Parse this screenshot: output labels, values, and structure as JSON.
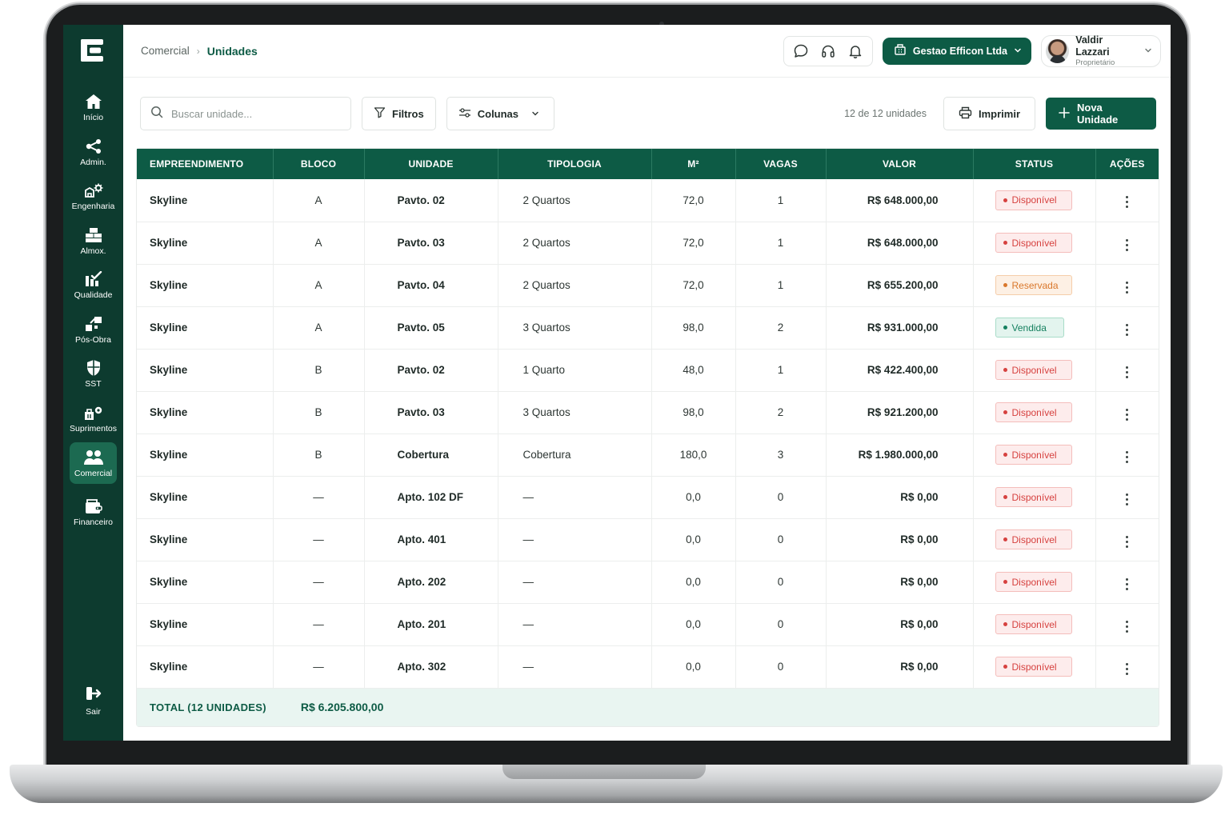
{
  "sidebar": {
    "items": [
      {
        "label": "Início",
        "icon": "home-icon"
      },
      {
        "label": "Admin.",
        "icon": "share-network-icon"
      },
      {
        "label": "Engenharia",
        "icon": "engineering-icon"
      },
      {
        "label": "Almox.",
        "icon": "warehouse-icon"
      },
      {
        "label": "Qualidade",
        "icon": "quality-check-icon"
      },
      {
        "label": "Pós-Obra",
        "icon": "post-construction-icon"
      },
      {
        "label": "SST",
        "icon": "shield-icon"
      },
      {
        "label": "Suprimentos",
        "icon": "supplies-icon"
      },
      {
        "label": "Comercial",
        "icon": "users-icon",
        "active": true
      },
      {
        "label": "Financeiro",
        "icon": "wallet-icon"
      }
    ],
    "logout_label": "Sair"
  },
  "header": {
    "breadcrumb_parent": "Comercial",
    "breadcrumb_current": "Unidades",
    "company": "Gestao Efficon Ltda",
    "user_name": "Valdir Lazzari",
    "user_role": "Proprietário"
  },
  "toolbar": {
    "search_placeholder": "Buscar unidade...",
    "filters_label": "Filtros",
    "columns_label": "Colunas",
    "count_text": "12 de 12 unidades",
    "print_label": "Imprimir",
    "new_label": "Nova Unidade"
  },
  "table": {
    "headers": [
      "EMPREENDIMENTO",
      "BLOCO",
      "UNIDADE",
      "TIPOLOGIA",
      "M²",
      "VAGAS",
      "VALOR",
      "STATUS",
      "AÇÕES"
    ],
    "rows": [
      {
        "emp": "Skyline",
        "bloco": "A",
        "unidade": "Pavto. 02",
        "tipologia": "2 Quartos",
        "m2": "72,0",
        "vagas": "1",
        "valor": "R$ 648.000,00",
        "status": "Disponível",
        "status_type": "disponivel"
      },
      {
        "emp": "Skyline",
        "bloco": "A",
        "unidade": "Pavto. 03",
        "tipologia": "2 Quartos",
        "m2": "72,0",
        "vagas": "1",
        "valor": "R$ 648.000,00",
        "status": "Disponível",
        "status_type": "disponivel"
      },
      {
        "emp": "Skyline",
        "bloco": "A",
        "unidade": "Pavto. 04",
        "tipologia": "2 Quartos",
        "m2": "72,0",
        "vagas": "1",
        "valor": "R$ 655.200,00",
        "status": "Reservada",
        "status_type": "reservada"
      },
      {
        "emp": "Skyline",
        "bloco": "A",
        "unidade": "Pavto. 05",
        "tipologia": "3 Quartos",
        "m2": "98,0",
        "vagas": "2",
        "valor": "R$ 931.000,00",
        "status": "Vendida",
        "status_type": "vendida"
      },
      {
        "emp": "Skyline",
        "bloco": "B",
        "unidade": "Pavto. 02",
        "tipologia": "1 Quarto",
        "m2": "48,0",
        "vagas": "1",
        "valor": "R$ 422.400,00",
        "status": "Disponível",
        "status_type": "disponivel"
      },
      {
        "emp": "Skyline",
        "bloco": "B",
        "unidade": "Pavto. 03",
        "tipologia": "3 Quartos",
        "m2": "98,0",
        "vagas": "2",
        "valor": "R$ 921.200,00",
        "status": "Disponível",
        "status_type": "disponivel"
      },
      {
        "emp": "Skyline",
        "bloco": "B",
        "unidade": "Cobertura",
        "tipologia": "Cobertura",
        "m2": "180,0",
        "vagas": "3",
        "valor": "R$ 1.980.000,00",
        "status": "Disponível",
        "status_type": "disponivel"
      },
      {
        "emp": "Skyline",
        "bloco": "—",
        "unidade": "Apto. 102 DF",
        "tipologia": "—",
        "m2": "0,0",
        "vagas": "0",
        "valor": "R$ 0,00",
        "status": "Disponível",
        "status_type": "disponivel"
      },
      {
        "emp": "Skyline",
        "bloco": "—",
        "unidade": "Apto. 401",
        "tipologia": "—",
        "m2": "0,0",
        "vagas": "0",
        "valor": "R$ 0,00",
        "status": "Disponível",
        "status_type": "disponivel"
      },
      {
        "emp": "Skyline",
        "bloco": "—",
        "unidade": "Apto. 202",
        "tipologia": "—",
        "m2": "0,0",
        "vagas": "0",
        "valor": "R$ 0,00",
        "status": "Disponível",
        "status_type": "disponivel"
      },
      {
        "emp": "Skyline",
        "bloco": "—",
        "unidade": "Apto. 201",
        "tipologia": "—",
        "m2": "0,0",
        "vagas": "0",
        "valor": "R$ 0,00",
        "status": "Disponível",
        "status_type": "disponivel"
      },
      {
        "emp": "Skyline",
        "bloco": "—",
        "unidade": "Apto. 302",
        "tipologia": "—",
        "m2": "0,0",
        "vagas": "0",
        "valor": "R$ 0,00",
        "status": "Disponível",
        "status_type": "disponivel"
      }
    ],
    "total_label": "TOTAL (12 UNIDADES)",
    "total_value": "R$ 6.205.800,00"
  },
  "colors": {
    "brand": "#0d5b45",
    "sidebar": "#0d3b2f",
    "disponivel": "#d6413f",
    "reservada": "#d9772b",
    "vendida": "#15805f"
  }
}
